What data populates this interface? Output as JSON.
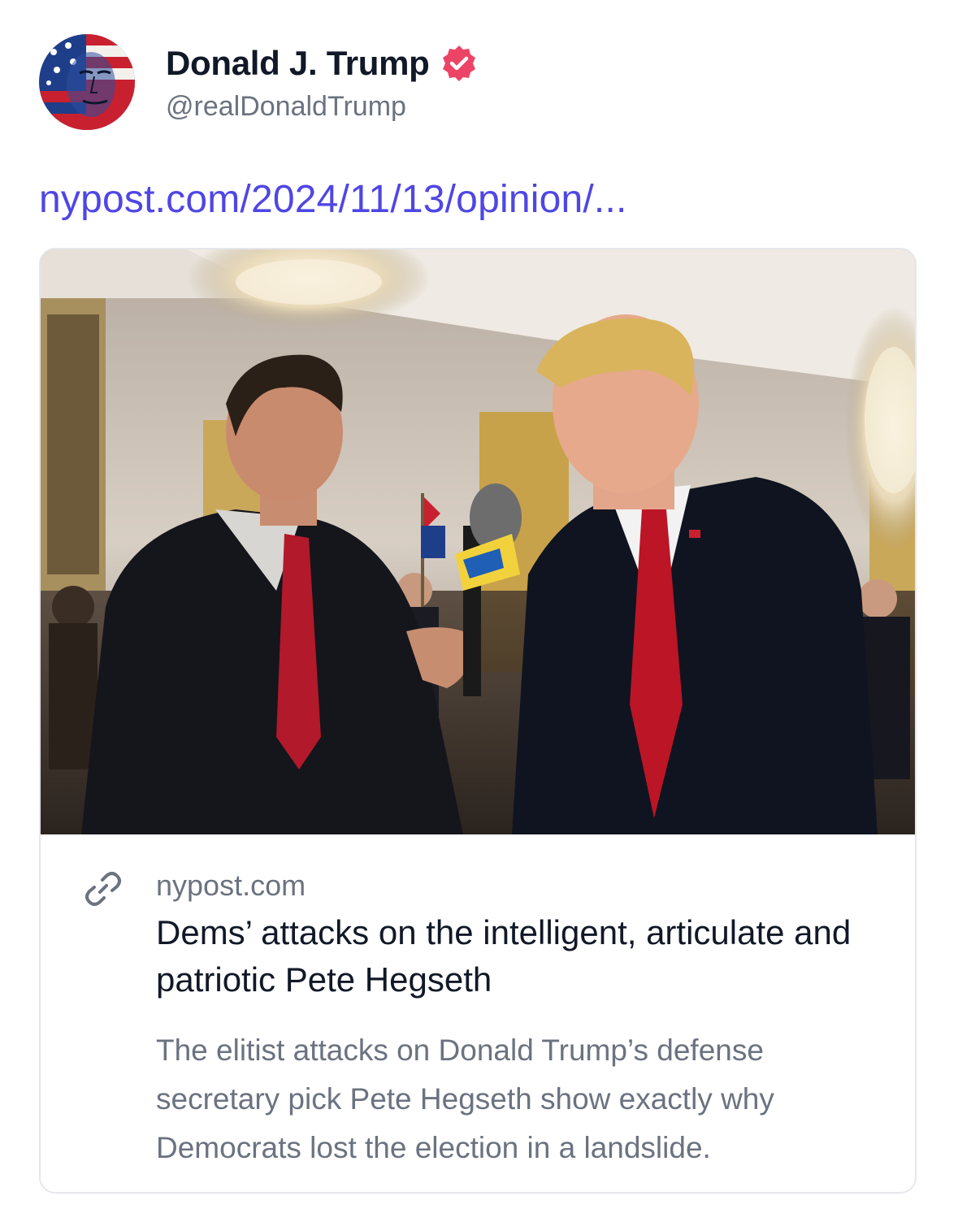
{
  "post": {
    "author": {
      "display_name": "Donald J. Trump",
      "handle": "@realDonaldTrump",
      "verified": true,
      "avatar_icon": "flag-portrait-avatar"
    },
    "link_text": "nypost.com/2024/11/13/opinion/..."
  },
  "link_card": {
    "image_icon": "article-photo",
    "link_icon": "link-icon",
    "domain": "nypost.com",
    "title": "Dems’ attacks on the intelligent, articulate and patriotic Pete Hegseth",
    "description": "The elitist attacks on Donald Trump’s defense secretary pick Pete Hegseth show exactly why Democrats lost the election in a landslide."
  },
  "colors": {
    "link": "#4f46e5",
    "verified_badge": "#ec4466",
    "muted_text": "#6b7280",
    "primary_text": "#111827",
    "card_border": "#e5e7eb"
  }
}
